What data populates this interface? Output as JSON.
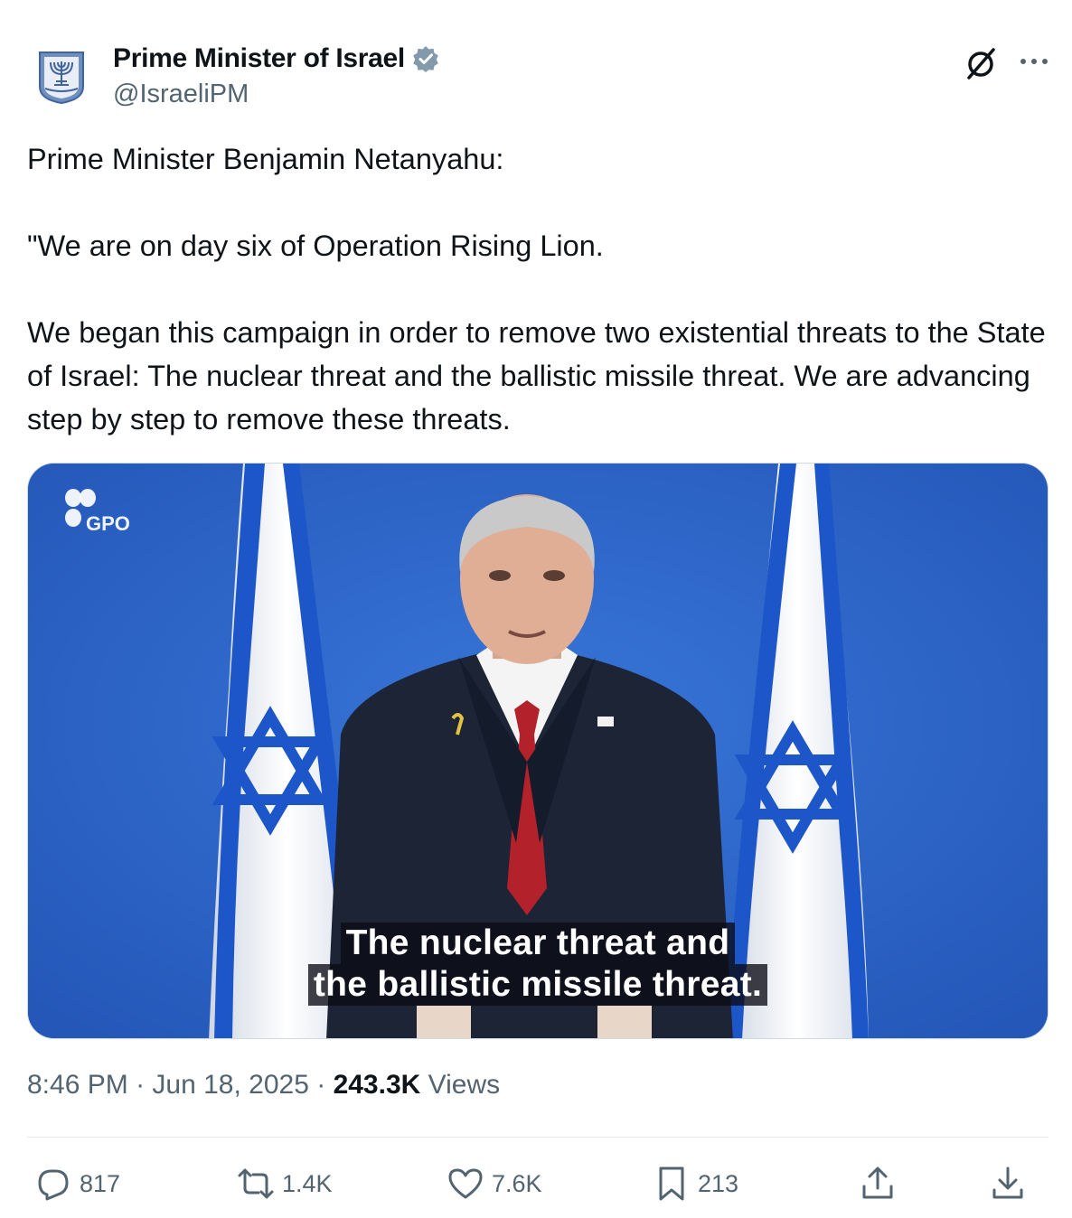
{
  "author": {
    "display_name": "Prime Minister of Israel",
    "handle": "@IsraeliPM",
    "verified": true,
    "icons": [
      "emblem-avatar",
      "verified-badge-icon",
      "grok-icon",
      "more-icon"
    ]
  },
  "tweet": {
    "paragraphs": [
      "Prime Minister Benjamin Netanyahu:",
      "\"We are on day six of Operation Rising Lion.",
      "We began this campaign in order to remove two existential threats to the State of Israel: The nuclear threat and the ballistic missile threat. We are advancing step by step to remove these threats."
    ]
  },
  "media": {
    "watermark": "GPO",
    "subtitle_line1": "The nuclear threat and",
    "subtitle_line2": "the ballistic missile threat."
  },
  "meta": {
    "time": "8:46 PM",
    "separator": " · ",
    "date": "Jun 18, 2025",
    "views_count": "243.3K",
    "views_label": " Views"
  },
  "actions": {
    "reply": "817",
    "repost": "1.4K",
    "like": "7.6K",
    "bookmark": "213"
  },
  "colors": {
    "text_primary": "#0f1419",
    "text_secondary": "#536471",
    "verified_badge": "#829aab",
    "background": "#ffffff",
    "video_backdrop": "#2c64c8"
  }
}
